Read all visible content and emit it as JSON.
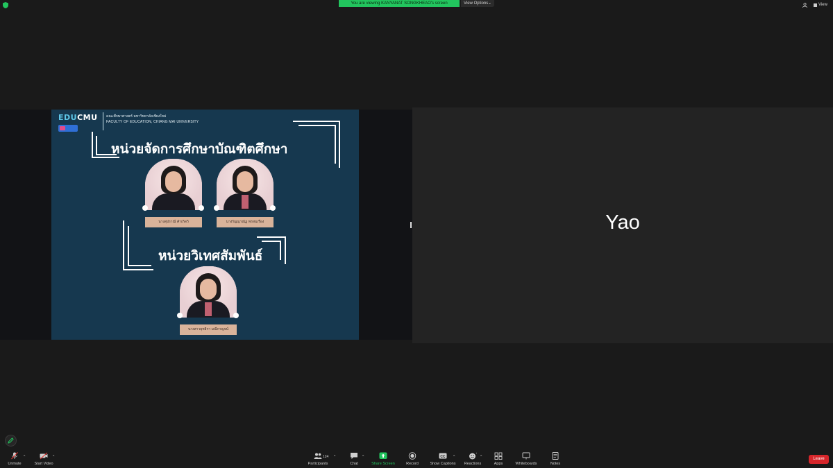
{
  "topbar": {
    "share_banner": "You are viewing KANYANAT SONGKHEAO's screen",
    "view_options": "View Options",
    "view": "View"
  },
  "slide": {
    "logo_edu": "EDU",
    "logo_cmu": "CMU",
    "faculty_th": "คณะศึกษาศาสตร์ มหาวิทยาลัยเชียงใหม่",
    "faculty_en": "FACULTY OF EDUCATION, CHIANG MAI UNIVERSITY",
    "heading_1": "หน่วยจัดการศึกษาบัณฑิตศึกษา",
    "heading_2": "หน่วยวิเทศสัมพันธ์",
    "people": [
      {
        "name": "นางสุปราณี คำเกิดวิ"
      },
      {
        "name": "นางรัญญาณัฏ พรหมเรือง"
      },
      {
        "name": "นางสาวยุทธิรา มณีกาญจน์"
      }
    ]
  },
  "participant_tile": {
    "name": "Yao"
  },
  "toolbar": {
    "unmute": "Unmute",
    "start_video": "Start Video",
    "participants": "Participants",
    "participant_count": "124",
    "chat": "Chat",
    "share_screen": "Share Screen",
    "record": "Record",
    "show_captions": "Show Captions",
    "reactions": "Reactions",
    "apps": "Apps",
    "whiteboards": "Whiteboards",
    "notes": "Notes",
    "leave": "Leave"
  },
  "colors": {
    "share_green": "#22c55e",
    "leave_red": "#d6262b",
    "slide_bg": "#16384f"
  }
}
